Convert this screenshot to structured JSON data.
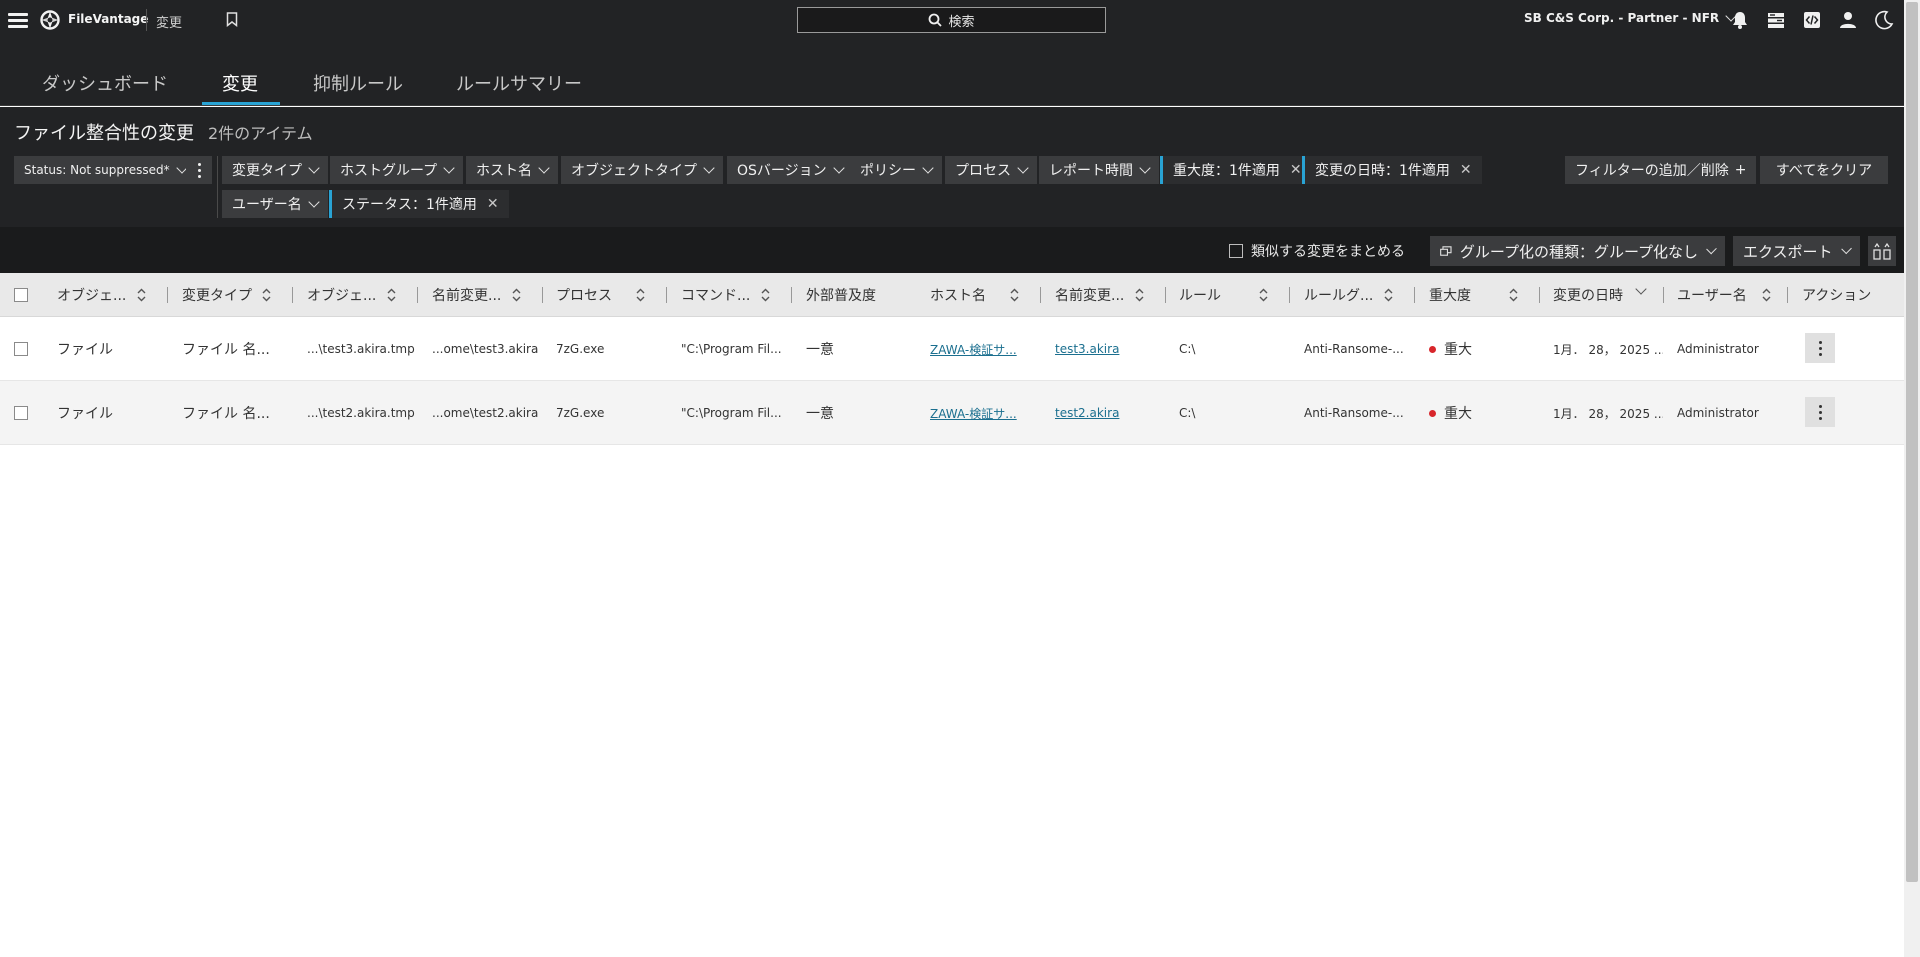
{
  "topbar": {
    "app_name": "FileVantage",
    "breadcrumb": "変更",
    "search_label": "検索",
    "org_name": "SB C&S Corp. - Partner - NFR"
  },
  "tabs": [
    {
      "label": "ダッシュボード"
    },
    {
      "label": "変更"
    },
    {
      "label": "抑制ルール"
    },
    {
      "label": "ルールサマリー"
    }
  ],
  "page": {
    "title": "ファイル整合性の変更",
    "count": "2件のアイテム"
  },
  "filters": {
    "status_filter": "Status: Not suppressed*",
    "chips": [
      {
        "label": "変更タイプ"
      },
      {
        "label": "ホストグループ"
      },
      {
        "label": "ホスト名"
      },
      {
        "label": "オブジェクトタイプ"
      },
      {
        "label": "OSバージョン"
      },
      {
        "label": "ポリシー"
      },
      {
        "label": "プロセス"
      },
      {
        "label": "レポート時間"
      },
      {
        "label": "ユーザー名"
      }
    ],
    "applied": [
      {
        "label": "重大度：1件適用"
      },
      {
        "label": "変更の日時：1件適用"
      },
      {
        "label": "ステータス：1件適用"
      }
    ],
    "add_remove": "フィルターの追加／削除",
    "clear_all": "すべてをクリア"
  },
  "toolbar": {
    "group_similar": "類似する変更をまとめる",
    "grouping": "グループ化の種類：グループ化なし",
    "export": "エクスポート"
  },
  "table": {
    "columns": [
      "オブジェ...",
      "変更タイプ",
      "オブジェ...",
      "名前変更...",
      "プロセス",
      "コマンド...",
      "外部普及度",
      "ホスト名",
      "名前変更...",
      "ルール",
      "ルールグ...",
      "重大度",
      "変更の日時",
      "ユーザー名",
      "アクション"
    ],
    "rows": [
      {
        "object_type": "ファイル",
        "change_type": "ファイル 名...",
        "object": "...\\test3.akira.tmp",
        "renamed_from": "...ome\\test3.akira",
        "process": "7zG.exe",
        "command": "\"C:\\Program Fil...",
        "prevalence": "一意",
        "host": "ZAWA-検証サ...",
        "renamed_to": "test3.akira",
        "rule": "C:\\",
        "rule_group": "Anti-Ransome-...",
        "severity": "重大",
        "datetime": "1月． 28， 2025 ...",
        "user": "Administrator"
      },
      {
        "object_type": "ファイル",
        "change_type": "ファイル 名...",
        "object": "...\\test2.akira.tmp",
        "renamed_from": "...ome\\test2.akira",
        "process": "7zG.exe",
        "command": "\"C:\\Program Fil...",
        "prevalence": "一意",
        "host": "ZAWA-検証サ...",
        "renamed_to": "test2.akira",
        "rule": "C:\\",
        "rule_group": "Anti-Ransome-...",
        "severity": "重大",
        "datetime": "1月． 28， 2025 ...",
        "user": "Administrator"
      }
    ]
  },
  "colors": {
    "topbar_bg": "#222325",
    "accent": "#29a3d4",
    "severity_critical": "#d8262b",
    "link": "#1b6f8f"
  }
}
